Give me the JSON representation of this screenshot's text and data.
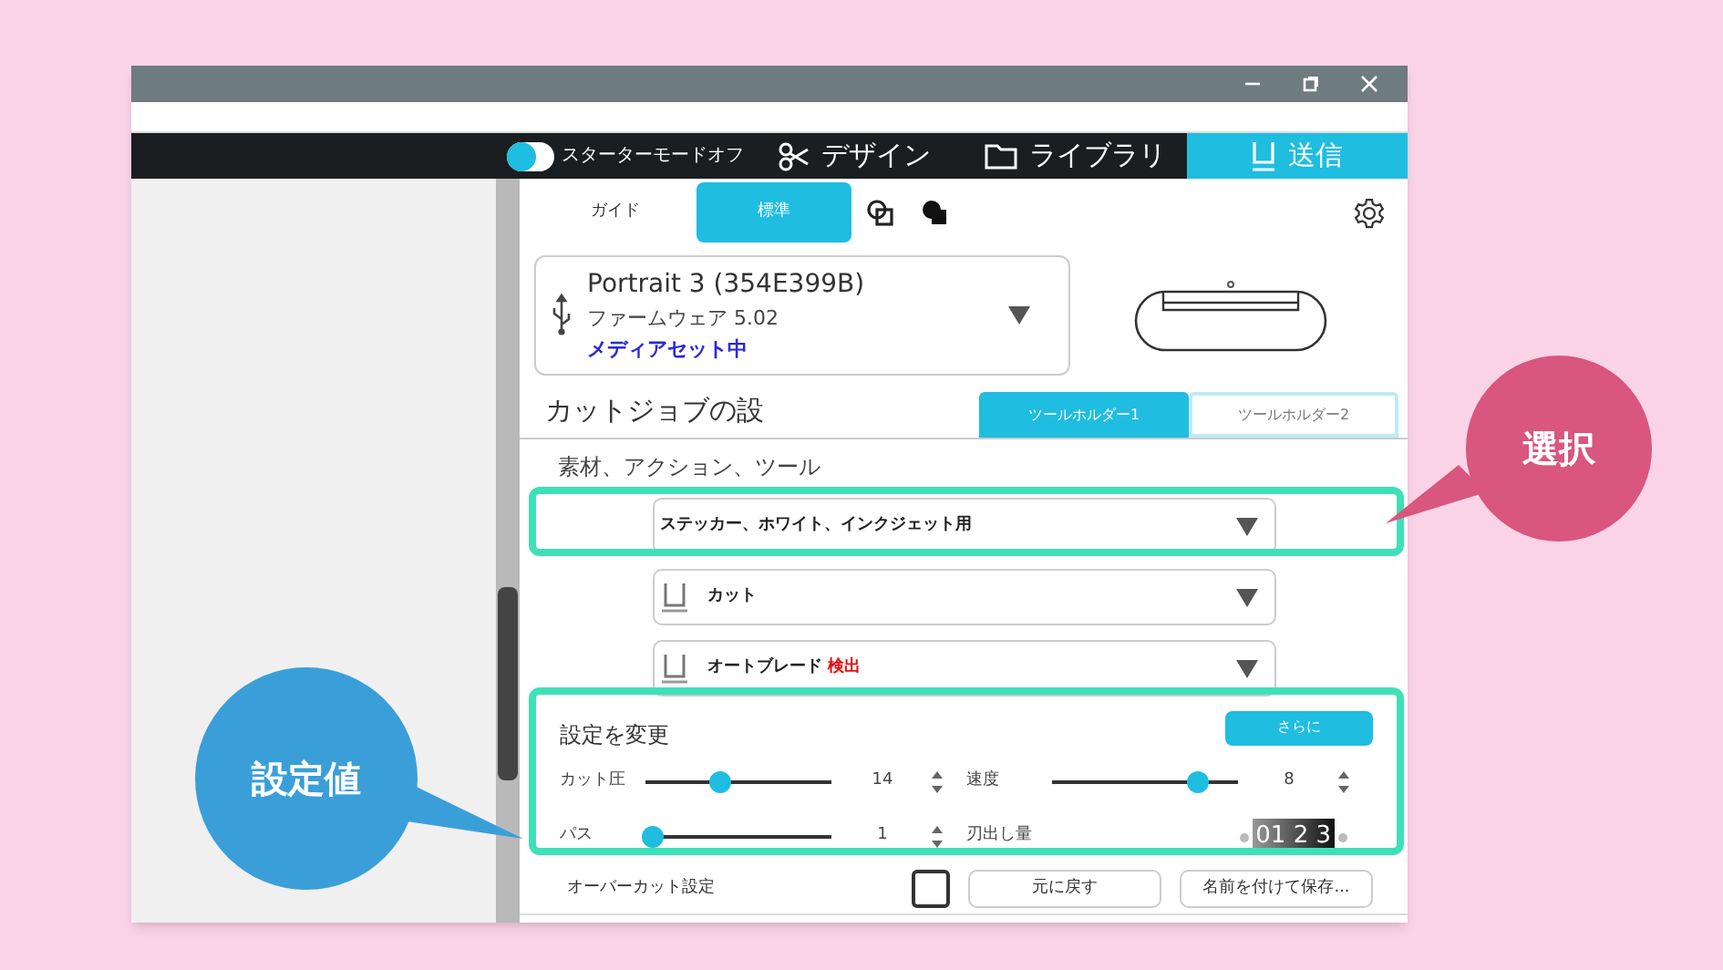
{
  "nav": {
    "starter_toggle": {
      "label": "スターターモードオフ",
      "on": false
    },
    "tabs": [
      {
        "label": "デザイン",
        "kind": "design",
        "selected": false
      },
      {
        "label": "ライブラリ",
        "kind": "library",
        "selected": false
      },
      {
        "label": "送信",
        "kind": "send",
        "selected": true
      }
    ]
  },
  "mode_tabs": [
    {
      "label": "ガイド",
      "selected": false
    },
    {
      "label": "標準",
      "selected": true
    }
  ],
  "device": {
    "name": "Portrait 3 (354E399B)",
    "firmware": "ファームウェア 5.02",
    "status": "メディアセット中"
  },
  "job": {
    "title": "カットジョブの設",
    "holder_tabs": [
      {
        "label": "ツールホルダー1",
        "selected": true
      },
      {
        "label": "ツールホルダー2",
        "selected": false
      }
    ],
    "materials_label": "素材、アクション、ツール",
    "dropdowns": [
      {
        "kind": "material",
        "text": "ステッカー、ホワイト、インクジェット用"
      },
      {
        "kind": "tool",
        "text": "カット"
      },
      {
        "kind": "tool",
        "text": "オートブレード",
        "badge": "検出"
      }
    ]
  },
  "settings": {
    "title": "設定を変更",
    "more_button": "さらに",
    "sliders": [
      {
        "label": "カット圧",
        "level": 0.4,
        "value": "14"
      },
      {
        "label": "速度",
        "level": 0.78,
        "value": "8"
      },
      {
        "label": "パス",
        "level": 0.04,
        "value": "1"
      }
    ],
    "blade": {
      "label": "刃出し量",
      "dial": "01 2 3"
    }
  },
  "footer": {
    "overcut_label": "オーバーカット設定",
    "overcut_checked": false,
    "buttons": [
      "元に戻す",
      "名前を付けて保存..."
    ]
  },
  "callouts": [
    {
      "text": "選択",
      "color": "#d9567e"
    },
    {
      "text": "設定値",
      "color": "#3a9fd8"
    }
  ]
}
